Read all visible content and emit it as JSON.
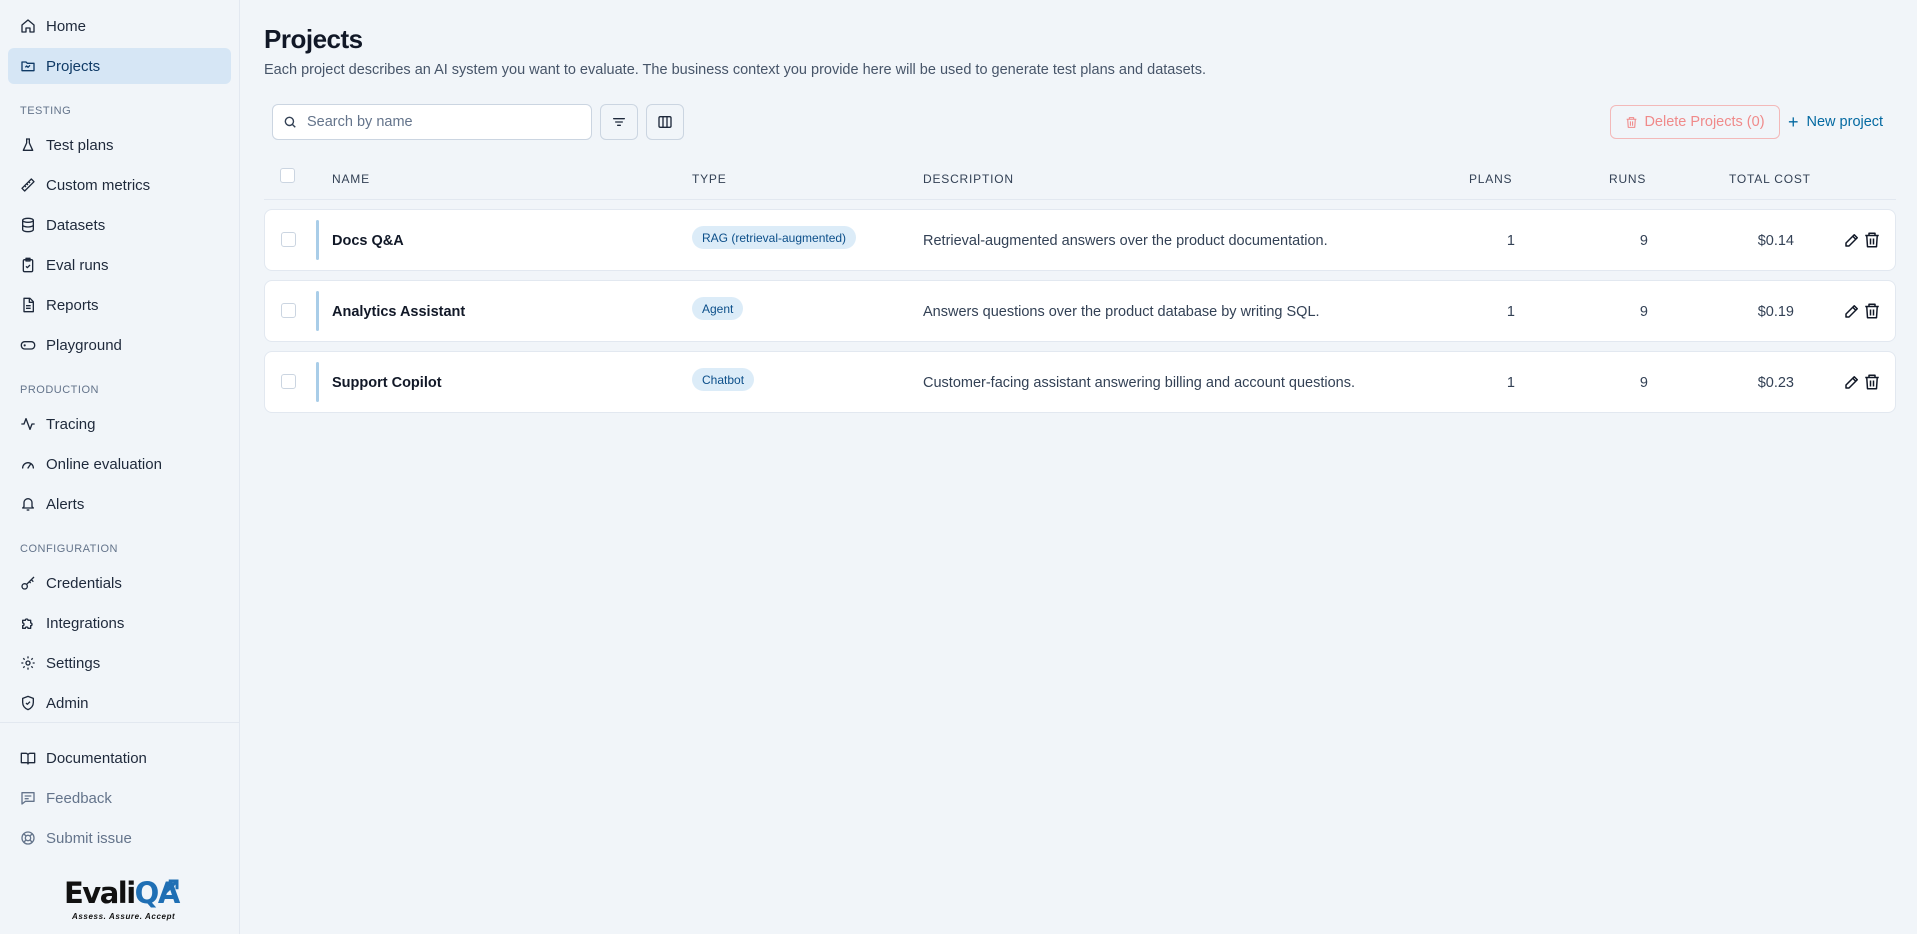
{
  "sidebar": {
    "top_items": [
      {
        "label": "Home",
        "icon": "home-icon"
      },
      {
        "label": "Projects",
        "icon": "folder-icon",
        "active": true
      }
    ],
    "sections": [
      {
        "label": "TESTING",
        "items": [
          {
            "label": "Test plans",
            "icon": "flask-icon"
          },
          {
            "label": "Custom metrics",
            "icon": "ruler-icon"
          },
          {
            "label": "Datasets",
            "icon": "database-icon"
          },
          {
            "label": "Eval runs",
            "icon": "clipboard-check-icon"
          },
          {
            "label": "Reports",
            "icon": "report-icon"
          },
          {
            "label": "Playground",
            "icon": "gamepad-icon"
          }
        ]
      },
      {
        "label": "PRODUCTION",
        "items": [
          {
            "label": "Tracing",
            "icon": "activity-icon"
          },
          {
            "label": "Online evaluation",
            "icon": "gauge-icon"
          },
          {
            "label": "Alerts",
            "icon": "bell-icon"
          }
        ]
      },
      {
        "label": "CONFIGURATION",
        "items": [
          {
            "label": "Credentials",
            "icon": "key-icon"
          },
          {
            "label": "Integrations",
            "icon": "puzzle-icon"
          },
          {
            "label": "Settings",
            "icon": "gear-icon"
          },
          {
            "label": "Admin",
            "icon": "shield-icon"
          }
        ]
      }
    ],
    "footer_items": [
      {
        "label": "Documentation",
        "icon": "book-icon"
      },
      {
        "label": "Feedback",
        "icon": "message-icon"
      },
      {
        "label": "Submit issue",
        "icon": "lifebuoy-icon"
      }
    ],
    "logo": {
      "text_main": "Evali",
      "text_accent": "QA",
      "tagline": "Assess. Assure. Accept"
    }
  },
  "page": {
    "title": "Projects",
    "subtitle": "Each project describes an AI system you want to evaluate. The business context you provide here will be used to generate test plans and datasets."
  },
  "toolbar": {
    "search_placeholder": "Search by name",
    "search_value": "",
    "delete_label": "Delete Projects (0)",
    "new_label": "New project"
  },
  "table": {
    "columns": [
      "NAME",
      "TYPE",
      "DESCRIPTION",
      "PLANS",
      "RUNS",
      "TOTAL COST"
    ],
    "rows": [
      {
        "name": "Docs Q&A",
        "type": "RAG (retrieval-augmented)",
        "description": "Retrieval-augmented answers over the product documentation.",
        "plans": "1",
        "runs": "9",
        "cost": "$0.14"
      },
      {
        "name": "Analytics Assistant",
        "type": "Agent",
        "description": "Answers questions over the product database by writing SQL.",
        "plans": "1",
        "runs": "9",
        "cost": "$0.19"
      },
      {
        "name": "Support Copilot",
        "type": "Chatbot",
        "description": "Customer-facing assistant answering billing and account questions.",
        "plans": "1",
        "runs": "9",
        "cost": "$0.23"
      }
    ]
  },
  "colors": {
    "accent": "#0369a1",
    "active_nav": "#d6e6f5",
    "badge_bg": "#dcecf8",
    "danger": "#f08a8a"
  }
}
